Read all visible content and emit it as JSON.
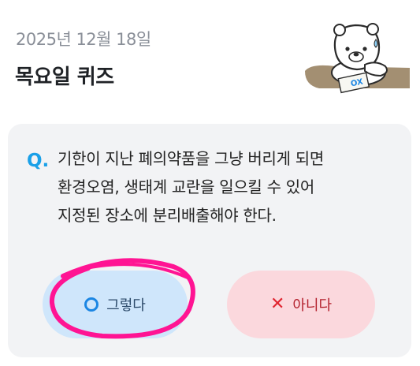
{
  "header": {
    "date": "2025년 12월 18일",
    "title": "목요일 퀴즈",
    "mascot_sign": "OX"
  },
  "quiz": {
    "q_label": "Q.",
    "question_lines": [
      "기한이 지난 폐의약품을 그냥 버리게 되면",
      "환경오염, 생태계 교란을 일으킬 수 있어",
      "지정된 장소에 분리배출해야 한다."
    ]
  },
  "answers": {
    "yes": {
      "icon": "circle-o-icon",
      "label": "그렇다"
    },
    "no": {
      "icon": "x-mark-icon",
      "label": "아니다"
    }
  },
  "colors": {
    "accent_blue": "#1aa0e8",
    "yes_bg": "#cfe6fb",
    "no_bg": "#fbd8dd",
    "no_text": "#e0242f",
    "annotation": "#ff1493"
  }
}
